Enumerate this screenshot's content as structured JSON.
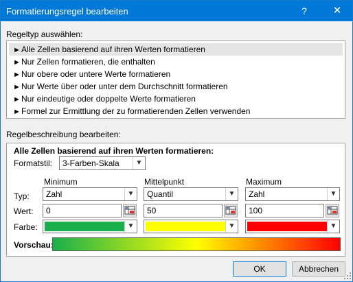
{
  "window": {
    "title": "Formatierungsregel bearbeiten",
    "help_label": "?",
    "close_label": "✕"
  },
  "rule_type": {
    "heading": "Regeltyp auswählen:",
    "items": [
      {
        "label": "Alle Zellen basierend auf ihren Werten formatieren",
        "selected": true
      },
      {
        "label": "Nur Zellen formatieren, die enthalten",
        "selected": false
      },
      {
        "label": "Nur obere oder untere Werte formatieren",
        "selected": false
      },
      {
        "label": "Nur Werte über oder unter dem Durchschnitt formatieren",
        "selected": false
      },
      {
        "label": "Nur eindeutige oder doppelte Werte formatieren",
        "selected": false
      },
      {
        "label": "Formel zur Ermittlung der zu formatierenden Zellen verwenden",
        "selected": false
      }
    ],
    "item_arrow": "►"
  },
  "description": {
    "heading": "Regelbeschreibung bearbeiten:",
    "panel_title": "Alle Zellen basierend auf ihren Werten formatieren:",
    "format_style_label": "Formatstil:",
    "format_style_value": "3-Farben-Skala",
    "row_labels": {
      "type": "Typ:",
      "value": "Wert:",
      "color": "Farbe:"
    },
    "columns": [
      {
        "header": "Minimum",
        "type": "Zahl",
        "value": "0",
        "color": "#1aaf4b"
      },
      {
        "header": "Mittelpunkt",
        "type": "Quantil",
        "value": "50",
        "color": "#ffff00"
      },
      {
        "header": "Maximum",
        "type": "Zahl",
        "value": "100",
        "color": "#ff0000"
      }
    ],
    "preview_label": "Vorschau:"
  },
  "buttons": {
    "ok": "OK",
    "cancel": "Abbrechen"
  },
  "colors": {
    "title_bar": "#0078d7",
    "dialog_bg": "#f0f0f0"
  }
}
